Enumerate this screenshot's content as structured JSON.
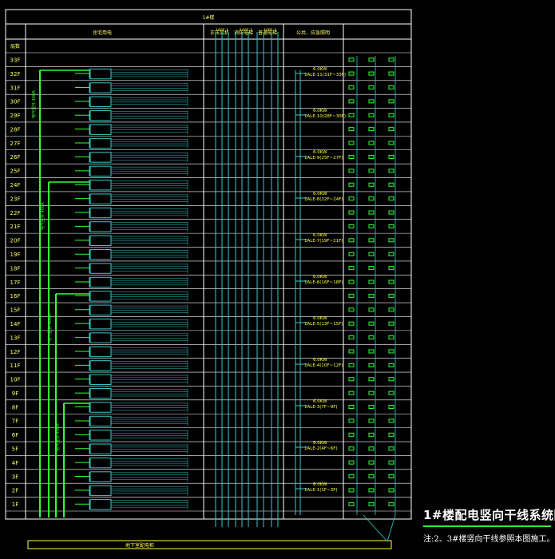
{
  "drawing": {
    "top_label": "1#楼",
    "col_headers": {
      "residential": "住宅用电",
      "fan": "正压风机",
      "fire_elev": "消防电梯",
      "elev": "普通电梯",
      "public": "公共、应急照明"
    },
    "floor_header": "层数",
    "floors": [
      "33F",
      "32F",
      "31F",
      "30F",
      "29F",
      "28F",
      "27F",
      "26F",
      "25F",
      "24F",
      "23F",
      "22F",
      "21F",
      "20F",
      "19F",
      "18F",
      "17F",
      "16F",
      "15F",
      "14F",
      "13F",
      "12F",
      "11F",
      "10F",
      "9F",
      "8F",
      "7F",
      "6F",
      "5F",
      "4F",
      "3F",
      "2F",
      "1F"
    ],
    "riser_labels": [
      "电气竖井 400A",
      "电气竖井 400A",
      "电气竖井 400A",
      "电气竖井 400A"
    ],
    "top_boxes": [
      "1APE-1",
      "1APE-2",
      "1APE-3"
    ],
    "lighting_panels": [
      {
        "kw": "6.0KW",
        "label": "1ALE-11(31F~33F)"
      },
      {
        "kw": "6.0KW",
        "label": "1ALE-10(28F~30F)"
      },
      {
        "kw": "6.0KW",
        "label": "1ALE-9(25F~27F)"
      },
      {
        "kw": "6.0KW",
        "label": "1ALE-8(22F~24F)"
      },
      {
        "kw": "6.0KW",
        "label": "1ALE-7(19F~21F)"
      },
      {
        "kw": "6.0KW",
        "label": "1ALE-6(16F~18F)"
      },
      {
        "kw": "6.0KW",
        "label": "1ALE-5(13F~15F)"
      },
      {
        "kw": "6.0KW",
        "label": "1ALE-4(10F~12F)"
      },
      {
        "kw": "6.0KW",
        "label": "1ALE-3(7F~9F)"
      },
      {
        "kw": "6.0KW",
        "label": "1ALE-2(4F~6F)"
      },
      {
        "kw": "6.0KW",
        "label": "1ALE-1(1F~3F)"
      }
    ],
    "basement_label": "地下室配电柜",
    "main_title": "1#楼配电竖向干线系统图",
    "note": "注:2、3#楼竖向干线参照本图施工。"
  },
  "colors": {
    "background": "#000000",
    "frame": "#ffffff",
    "riser": "#33ff33",
    "cyan": "#33cccc",
    "yellow": "#ffff33",
    "label": "#ffff66"
  }
}
